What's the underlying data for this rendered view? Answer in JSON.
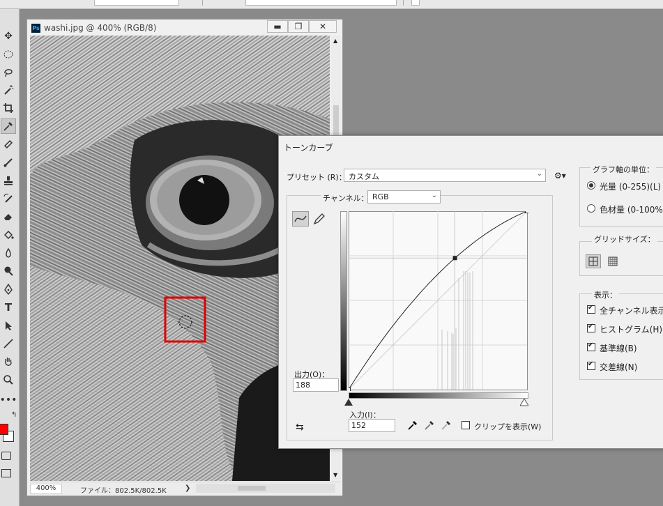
{
  "document": {
    "title": "washi.jpg @ 400% (RGB/8)",
    "ps_badge": "Ps",
    "min_btn": "▬",
    "max_btn": "❐",
    "close_btn": "✕",
    "zoom": "400%",
    "file_info": "ファイル：802.5K/802.5K",
    "status_arrow": "❯"
  },
  "tools": [
    "move-icon",
    "marquee-icon",
    "lasso-icon",
    "magic-wand-icon",
    "crop-icon",
    "eyedropper-icon",
    "healing-icon",
    "brush-icon",
    "stamp-icon",
    "history-brush-icon",
    "eraser-icon",
    "paint-bucket-icon",
    "blur-icon",
    "dodge-icon",
    "pen-icon",
    "type-icon",
    "path-select-icon",
    "line-icon",
    "hand-icon",
    "zoom-icon",
    "more-icon"
  ],
  "colors": {
    "foreground": "#ff0000",
    "background": "#ffffff",
    "selection_box": "#e00000"
  },
  "curves": {
    "title": "トーンカーブ",
    "preset_label": "プリセット (R)：",
    "preset_value": "カスタム",
    "channel_label": "チャンネル：",
    "channel_value": "RGB",
    "output_label": "出力(O)：",
    "output_value": "188",
    "input_label": "入力(I)：",
    "input_value": "152",
    "clip_label": "クリップを表示(W)",
    "point": {
      "input": 152,
      "output": 188
    },
    "units_label": "グラフ軸の単位：",
    "unit_light": "光量 (0-255)(L)",
    "unit_ink": "色材量 (0-100%",
    "grid_label": "グリッドサイズ：",
    "display_label": "表示：",
    "show_all_channels": "全チャンネル表示",
    "show_histogram": "ヒストグラム(H)",
    "show_baseline": "基準線(B)",
    "show_intersection": "交差線(N)"
  }
}
